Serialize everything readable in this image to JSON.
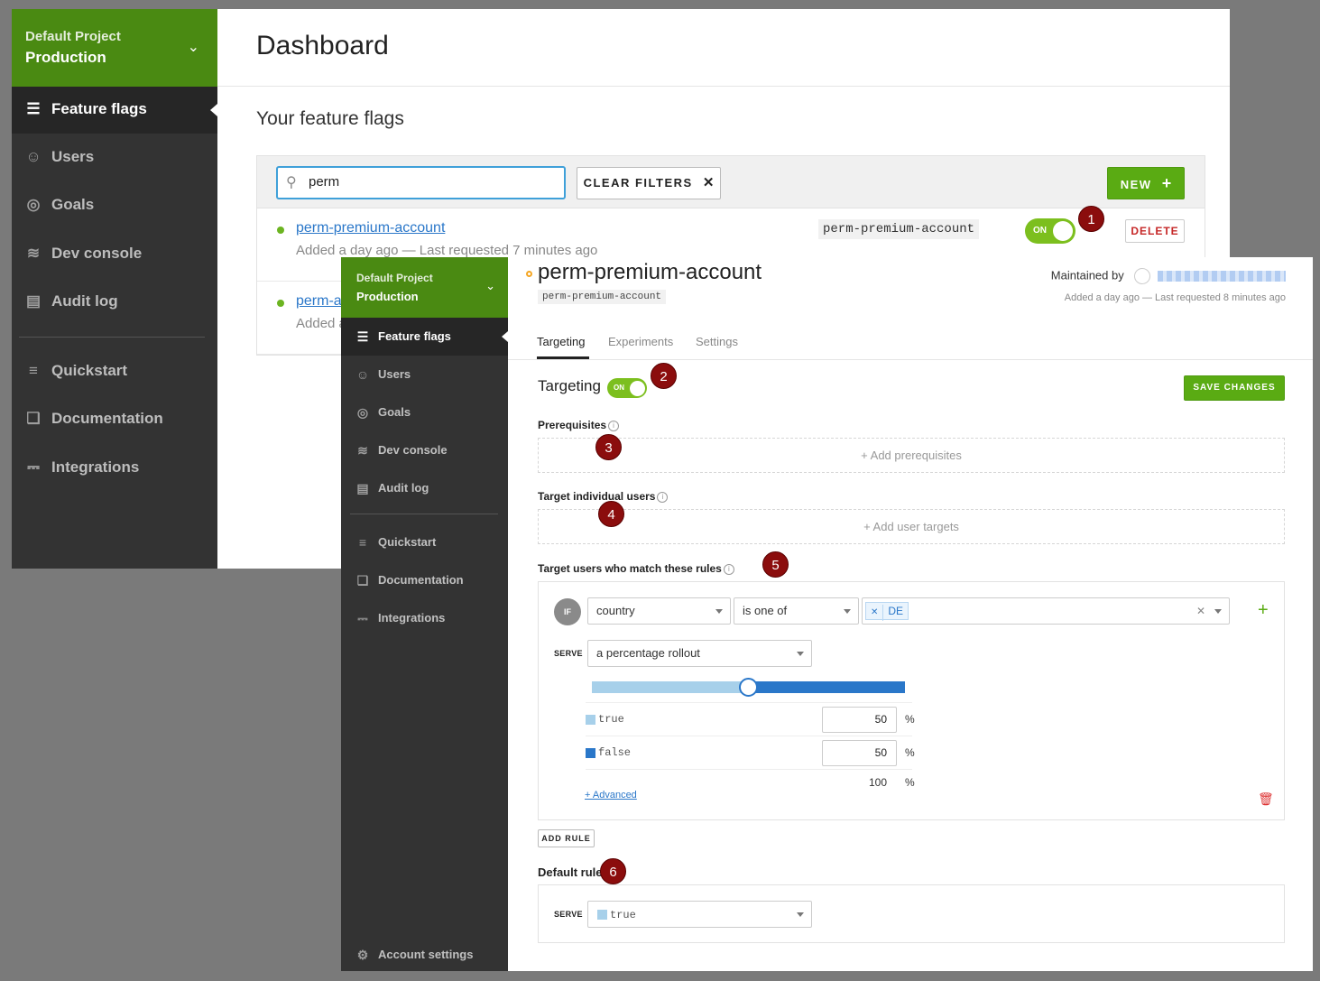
{
  "back": {
    "project": {
      "name": "Default Project",
      "env": "Production"
    },
    "nav": [
      {
        "label": "Feature flags",
        "icon": "sliders-icon"
      },
      {
        "label": "Users",
        "icon": "users-icon"
      },
      {
        "label": "Goals",
        "icon": "target-icon"
      },
      {
        "label": "Dev console",
        "icon": "waveform-icon"
      },
      {
        "label": "Audit log",
        "icon": "audit-icon"
      },
      {
        "label": "Quickstart",
        "icon": "signpost-icon"
      },
      {
        "label": "Documentation",
        "icon": "docs-icon"
      },
      {
        "label": "Integrations",
        "icon": "plug-icon"
      }
    ],
    "title": "Dashboard",
    "section_title": "Your feature flags",
    "search": {
      "value": "perm"
    },
    "clear_filters": "CLEAR FILTERS",
    "new_button": "NEW",
    "flags": [
      {
        "name": "perm-premium-account",
        "meta": "Added a day ago — Last requested 7 minutes ago",
        "key": "perm-premium-account",
        "toggle": "ON",
        "delete": "DELETE"
      },
      {
        "name": "perm-a",
        "meta": "Added a"
      }
    ]
  },
  "front": {
    "project": {
      "name": "Default Project",
      "env": "Production"
    },
    "nav": [
      {
        "label": "Feature flags",
        "icon": "sliders-icon"
      },
      {
        "label": "Users",
        "icon": "users-icon"
      },
      {
        "label": "Goals",
        "icon": "target-icon"
      },
      {
        "label": "Dev console",
        "icon": "waveform-icon"
      },
      {
        "label": "Audit log",
        "icon": "audit-icon"
      },
      {
        "label": "Quickstart",
        "icon": "signpost-icon"
      },
      {
        "label": "Documentation",
        "icon": "docs-icon"
      },
      {
        "label": "Integrations",
        "icon": "plug-icon"
      }
    ],
    "account_settings": "Account settings",
    "flag": {
      "title": "perm-premium-account",
      "key": "perm-premium-account",
      "maintained_by": "Maintained by",
      "meta": "Added a day ago — Last requested 8 minutes ago"
    },
    "tabs": [
      "Targeting",
      "Experiments",
      "Settings"
    ],
    "targeting": {
      "title": "Targeting",
      "toggle": "ON",
      "save": "SAVE CHANGES",
      "prerequisites": {
        "title": "Prerequisites",
        "add": "+ Add prerequisites"
      },
      "individual": {
        "title": "Target individual users",
        "add": "+ Add user targets"
      },
      "rules_title": "Target users who match these rules",
      "rule": {
        "if": "IF",
        "attribute": "country",
        "operator": "is one of",
        "values": [
          "DE"
        ],
        "serve_label": "SERVE",
        "serve": "a percentage rollout",
        "variations": [
          {
            "name": "true",
            "percent": "50",
            "color": "#a7d0ea"
          },
          {
            "name": "false",
            "percent": "50",
            "color": "#2a77c9"
          }
        ],
        "total": "100",
        "pct": "%",
        "advanced": "+ Advanced"
      },
      "add_rule": "ADD RULE",
      "default_rule": {
        "title": "Default rule",
        "serve_label": "SERVE",
        "value": "true",
        "color": "#a7d0ea"
      }
    }
  },
  "annotations": [
    "1",
    "2",
    "3",
    "4",
    "5",
    "6"
  ],
  "colors": {
    "brand_green": "#4a8a12",
    "button_green": "#5aab13",
    "sidebar": "#333333",
    "link_blue": "#2a77c9",
    "badge_red": "#8b0d0d"
  }
}
